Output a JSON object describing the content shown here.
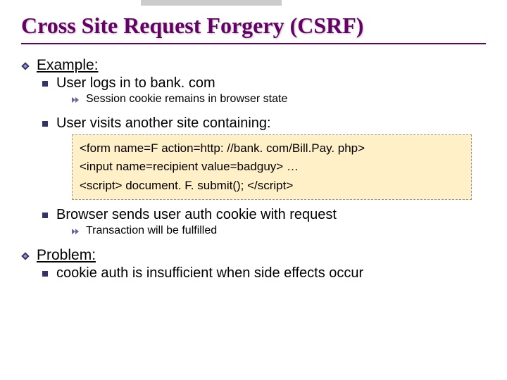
{
  "title": "Cross Site Request Forgery  (CSRF)",
  "section1": {
    "heading": "Example:",
    "item1": "User logs in to  bank. com",
    "item1_sub": "Session cookie remains in browser state",
    "item2": "User visits another site containing:",
    "code_line1": "<form  name=F  action=http: //bank. com/Bill.Pay. php>",
    "code_line2": "<input  name=recipient   value=badguy> …",
    "code_line3": "<script> document. F. submit(); </script>",
    "item3": "Browser sends user auth cookie with request",
    "item3_sub": "Transaction will be fulfilled"
  },
  "section2": {
    "heading": "Problem:",
    "item1": "cookie auth is insufficient when side effects occur"
  }
}
